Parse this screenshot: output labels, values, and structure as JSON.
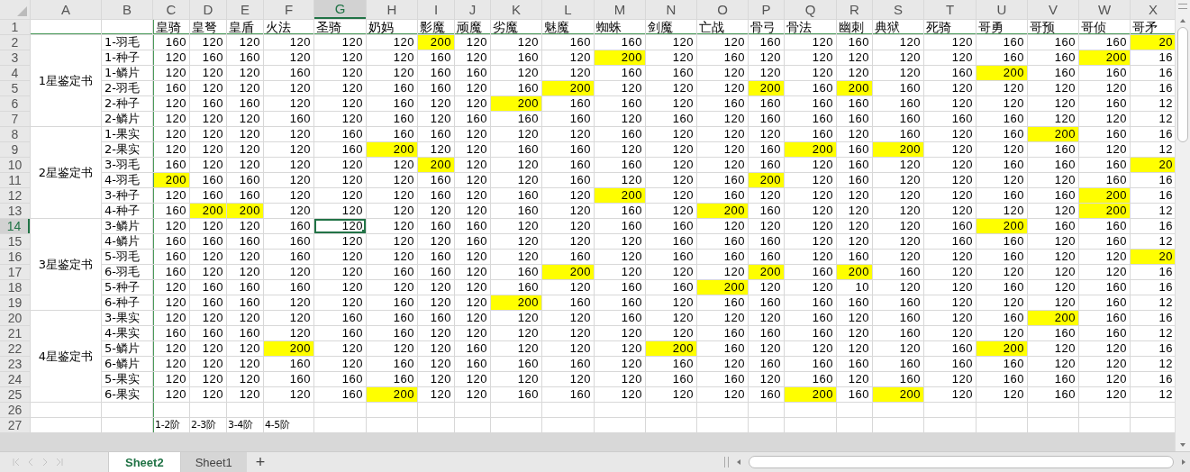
{
  "sheet": {
    "column_letters": [
      {
        "letter": "A",
        "selected": false
      },
      {
        "letter": "B",
        "selected": false
      },
      {
        "letter": "C",
        "selected": false
      },
      {
        "letter": "D",
        "selected": false
      },
      {
        "letter": "E",
        "selected": false
      },
      {
        "letter": "F",
        "selected": false
      },
      {
        "letter": "G",
        "selected": true
      },
      {
        "letter": "H",
        "selected": false
      },
      {
        "letter": "I",
        "selected": false
      },
      {
        "letter": "J",
        "selected": false
      },
      {
        "letter": "K",
        "selected": false
      },
      {
        "letter": "L",
        "selected": false
      },
      {
        "letter": "M",
        "selected": false
      },
      {
        "letter": "N",
        "selected": false
      },
      {
        "letter": "O",
        "selected": false
      },
      {
        "letter": "P",
        "selected": false
      },
      {
        "letter": "Q",
        "selected": false
      },
      {
        "letter": "R",
        "selected": false
      },
      {
        "letter": "S",
        "selected": false
      },
      {
        "letter": "T",
        "selected": false
      },
      {
        "letter": "U",
        "selected": false
      },
      {
        "letter": "V",
        "selected": false
      },
      {
        "letter": "W",
        "selected": false
      },
      {
        "letter": "X",
        "selected": false
      }
    ],
    "header_row": {
      "number": "1",
      "selected": false,
      "cells": [
        "皇骑",
        "皇弩",
        "皇盾",
        "火法",
        "圣骑",
        "奶妈",
        "影魔",
        "顽魔",
        "劣魔",
        "魅魔",
        "蜘蛛",
        "剑魔",
        "亡战",
        "骨弓",
        "骨法",
        "幽刺",
        "典狱",
        "死骑",
        "哥勇",
        "哥预",
        "哥侦",
        "哥矛"
      ]
    },
    "groups": [
      {
        "label": "1星鉴定书",
        "rows": [
          {
            "number": "2",
            "selected": false,
            "label": "1-羽毛",
            "cells": [
              "160",
              "120",
              "120",
              "120",
              "120",
              "120",
              "200",
              "120",
              "120",
              "160",
              "160",
              "120",
              "120",
              "160",
              "120",
              "160",
              "120",
              "120",
              "160",
              "160",
              "160",
              "20"
            ],
            "highlighted": [
              false,
              false,
              false,
              false,
              false,
              false,
              true,
              false,
              false,
              false,
              false,
              false,
              false,
              false,
              false,
              false,
              false,
              false,
              false,
              false,
              false,
              true
            ]
          },
          {
            "number": "3",
            "selected": false,
            "label": "1-种子",
            "cells": [
              "120",
              "160",
              "160",
              "120",
              "120",
              "120",
              "160",
              "120",
              "160",
              "120",
              "200",
              "120",
              "160",
              "120",
              "120",
              "120",
              "120",
              "120",
              "160",
              "160",
              "200",
              "16"
            ],
            "highlighted": [
              false,
              false,
              false,
              false,
              false,
              false,
              false,
              false,
              false,
              false,
              true,
              false,
              false,
              false,
              false,
              false,
              false,
              false,
              false,
              false,
              true,
              false
            ]
          },
          {
            "number": "4",
            "selected": false,
            "label": "1-鳞片",
            "cells": [
              "120",
              "120",
              "120",
              "160",
              "120",
              "120",
              "160",
              "160",
              "120",
              "120",
              "160",
              "160",
              "120",
              "120",
              "120",
              "120",
              "120",
              "160",
              "200",
              "160",
              "160",
              "16"
            ],
            "highlighted": [
              false,
              false,
              false,
              false,
              false,
              false,
              false,
              false,
              false,
              false,
              false,
              false,
              false,
              false,
              false,
              false,
              false,
              false,
              true,
              false,
              false,
              false
            ]
          },
          {
            "number": "5",
            "selected": false,
            "label": "2-羽毛",
            "cells": [
              "160",
              "120",
              "120",
              "120",
              "120",
              "160",
              "160",
              "120",
              "160",
              "200",
              "120",
              "120",
              "120",
              "200",
              "160",
              "200",
              "160",
              "120",
              "120",
              "120",
              "120",
              "16"
            ],
            "highlighted": [
              false,
              false,
              false,
              false,
              false,
              false,
              false,
              false,
              false,
              true,
              false,
              false,
              false,
              true,
              false,
              true,
              false,
              false,
              false,
              false,
              false,
              false
            ]
          },
          {
            "number": "6",
            "selected": false,
            "label": "2-种子",
            "cells": [
              "120",
              "160",
              "160",
              "120",
              "120",
              "160",
              "120",
              "120",
              "200",
              "160",
              "160",
              "120",
              "160",
              "160",
              "160",
              "160",
              "160",
              "120",
              "120",
              "120",
              "160",
              "12"
            ],
            "highlighted": [
              false,
              false,
              false,
              false,
              false,
              false,
              false,
              false,
              true,
              false,
              false,
              false,
              false,
              false,
              false,
              false,
              false,
              false,
              false,
              false,
              false,
              false
            ]
          },
          {
            "number": "7",
            "selected": false,
            "label": "2-鳞片",
            "cells": [
              "120",
              "120",
              "120",
              "160",
              "120",
              "160",
              "120",
              "160",
              "160",
              "160",
              "120",
              "160",
              "120",
              "160",
              "160",
              "160",
              "160",
              "160",
              "160",
              "120",
              "120",
              "12"
            ],
            "highlighted": [
              false,
              false,
              false,
              false,
              false,
              false,
              false,
              false,
              false,
              false,
              false,
              false,
              false,
              false,
              false,
              false,
              false,
              false,
              false,
              false,
              false,
              false
            ]
          }
        ]
      },
      {
        "label": "2星鉴定书",
        "rows": [
          {
            "number": "8",
            "selected": false,
            "label": "1-果实",
            "cells": [
              "120",
              "120",
              "120",
              "120",
              "160",
              "160",
              "160",
              "120",
              "120",
              "120",
              "160",
              "120",
              "120",
              "120",
              "160",
              "120",
              "160",
              "120",
              "160",
              "200",
              "160",
              "16"
            ],
            "highlighted": [
              false,
              false,
              false,
              false,
              false,
              false,
              false,
              false,
              false,
              false,
              false,
              false,
              false,
              false,
              false,
              false,
              false,
              false,
              false,
              true,
              false,
              false
            ]
          },
          {
            "number": "9",
            "selected": false,
            "label": "2-果实",
            "cells": [
              "120",
              "120",
              "120",
              "120",
              "160",
              "200",
              "120",
              "120",
              "160",
              "160",
              "120",
              "120",
              "120",
              "160",
              "200",
              "160",
              "200",
              "120",
              "120",
              "160",
              "120",
              "12"
            ],
            "highlighted": [
              false,
              false,
              false,
              false,
              false,
              true,
              false,
              false,
              false,
              false,
              false,
              false,
              false,
              false,
              true,
              false,
              true,
              false,
              false,
              false,
              false,
              false
            ]
          },
          {
            "number": "10",
            "selected": false,
            "label": "3-羽毛",
            "cells": [
              "160",
              "120",
              "120",
              "120",
              "120",
              "120",
              "200",
              "120",
              "120",
              "160",
              "160",
              "120",
              "120",
              "160",
              "120",
              "160",
              "120",
              "120",
              "160",
              "160",
              "160",
              "20"
            ],
            "highlighted": [
              false,
              false,
              false,
              false,
              false,
              false,
              true,
              false,
              false,
              false,
              false,
              false,
              false,
              false,
              false,
              false,
              false,
              false,
              false,
              false,
              false,
              true
            ]
          },
          {
            "number": "11",
            "selected": false,
            "label": "4-羽毛",
            "cells": [
              "200",
              "160",
              "160",
              "120",
              "120",
              "120",
              "160",
              "120",
              "120",
              "160",
              "120",
              "120",
              "160",
              "200",
              "120",
              "160",
              "120",
              "120",
              "120",
              "120",
              "160",
              "16"
            ],
            "highlighted": [
              true,
              false,
              false,
              false,
              false,
              false,
              false,
              false,
              false,
              false,
              false,
              false,
              false,
              true,
              false,
              false,
              false,
              false,
              false,
              false,
              false,
              false
            ]
          },
          {
            "number": "12",
            "selected": false,
            "label": "3-种子",
            "cells": [
              "120",
              "160",
              "160",
              "120",
              "120",
              "120",
              "160",
              "120",
              "160",
              "120",
              "200",
              "120",
              "160",
              "120",
              "120",
              "120",
              "120",
              "120",
              "160",
              "160",
              "200",
              "16"
            ],
            "highlighted": [
              false,
              false,
              false,
              false,
              false,
              false,
              false,
              false,
              false,
              false,
              true,
              false,
              false,
              false,
              false,
              false,
              false,
              false,
              false,
              false,
              true,
              false
            ]
          },
          {
            "number": "13",
            "selected": false,
            "label": "4-种子",
            "cells": [
              "160",
              "200",
              "200",
              "120",
              "120",
              "120",
              "120",
              "120",
              "160",
              "120",
              "160",
              "120",
              "200",
              "160",
              "120",
              "120",
              "120",
              "120",
              "120",
              "120",
              "200",
              "12"
            ],
            "highlighted": [
              false,
              true,
              true,
              false,
              false,
              false,
              false,
              false,
              false,
              false,
              false,
              false,
              true,
              false,
              false,
              false,
              false,
              false,
              false,
              false,
              true,
              false
            ]
          }
        ]
      },
      {
        "label": "3星鉴定书",
        "rows": [
          {
            "number": "14",
            "selected": true,
            "label": "3-鳞片",
            "cells": [
              "120",
              "120",
              "120",
              "160",
              "120",
              "120",
              "160",
              "160",
              "120",
              "120",
              "160",
              "160",
              "120",
              "120",
              "120",
              "120",
              "120",
              "160",
              "200",
              "160",
              "160",
              "16"
            ],
            "highlighted": [
              false,
              false,
              false,
              false,
              false,
              false,
              false,
              false,
              false,
              false,
              false,
              false,
              false,
              false,
              false,
              false,
              false,
              false,
              true,
              false,
              false,
              false
            ]
          },
          {
            "number": "15",
            "selected": false,
            "label": "4-鳞片",
            "cells": [
              "160",
              "160",
              "160",
              "160",
              "120",
              "120",
              "120",
              "160",
              "120",
              "120",
              "120",
              "160",
              "160",
              "160",
              "120",
              "120",
              "120",
              "160",
              "160",
              "120",
              "160",
              "12"
            ],
            "highlighted": [
              false,
              false,
              false,
              false,
              false,
              false,
              false,
              false,
              false,
              false,
              false,
              false,
              false,
              false,
              false,
              false,
              false,
              false,
              false,
              false,
              false,
              false
            ]
          },
          {
            "number": "16",
            "selected": false,
            "label": "5-羽毛",
            "cells": [
              "160",
              "120",
              "120",
              "160",
              "120",
              "120",
              "160",
              "120",
              "120",
              "160",
              "120",
              "160",
              "160",
              "160",
              "120",
              "160",
              "120",
              "120",
              "160",
              "120",
              "120",
              "20"
            ],
            "highlighted": [
              false,
              false,
              false,
              false,
              false,
              false,
              false,
              false,
              false,
              false,
              false,
              false,
              false,
              false,
              false,
              false,
              false,
              false,
              false,
              false,
              false,
              true
            ]
          },
          {
            "number": "17",
            "selected": false,
            "label": "6-羽毛",
            "cells": [
              "160",
              "120",
              "120",
              "120",
              "120",
              "160",
              "160",
              "120",
              "160",
              "200",
              "120",
              "120",
              "120",
              "200",
              "160",
              "200",
              "160",
              "120",
              "120",
              "120",
              "120",
              "16"
            ],
            "highlighted": [
              false,
              false,
              false,
              false,
              false,
              false,
              false,
              false,
              false,
              true,
              false,
              false,
              false,
              true,
              false,
              true,
              false,
              false,
              false,
              false,
              false,
              false
            ]
          },
          {
            "number": "18",
            "selected": false,
            "label": "5-种子",
            "cells": [
              "120",
              "160",
              "160",
              "160",
              "120",
              "120",
              "120",
              "120",
              "160",
              "120",
              "160",
              "160",
              "200",
              "120",
              "120",
              "10",
              "120",
              "120",
              "160",
              "120",
              "160",
              "16"
            ],
            "highlighted": [
              false,
              false,
              false,
              false,
              false,
              false,
              false,
              false,
              false,
              false,
              false,
              false,
              true,
              false,
              false,
              false,
              false,
              false,
              false,
              false,
              false,
              false
            ]
          },
          {
            "number": "19",
            "selected": false,
            "label": "6-种子",
            "cells": [
              "120",
              "160",
              "160",
              "120",
              "120",
              "160",
              "120",
              "120",
              "200",
              "160",
              "160",
              "120",
              "160",
              "160",
              "160",
              "160",
              "160",
              "120",
              "120",
              "120",
              "160",
              "12"
            ],
            "highlighted": [
              false,
              false,
              false,
              false,
              false,
              false,
              false,
              false,
              true,
              false,
              false,
              false,
              false,
              false,
              false,
              false,
              false,
              false,
              false,
              false,
              false,
              false
            ]
          }
        ]
      },
      {
        "label": "4星鉴定书",
        "rows": [
          {
            "number": "20",
            "selected": false,
            "label": "3-果实",
            "cells": [
              "120",
              "120",
              "120",
              "120",
              "160",
              "160",
              "160",
              "120",
              "120",
              "120",
              "160",
              "120",
              "120",
              "120",
              "160",
              "120",
              "160",
              "120",
              "160",
              "200",
              "160",
              "16"
            ],
            "highlighted": [
              false,
              false,
              false,
              false,
              false,
              false,
              false,
              false,
              false,
              false,
              false,
              false,
              false,
              false,
              false,
              false,
              false,
              false,
              false,
              true,
              false,
              false
            ]
          },
          {
            "number": "21",
            "selected": false,
            "label": "4-果实",
            "cells": [
              "160",
              "160",
              "160",
              "120",
              "160",
              "160",
              "120",
              "120",
              "120",
              "120",
              "120",
              "120",
              "160",
              "160",
              "160",
              "120",
              "160",
              "120",
              "120",
              "160",
              "160",
              "12"
            ],
            "highlighted": [
              false,
              false,
              false,
              false,
              false,
              false,
              false,
              false,
              false,
              false,
              false,
              false,
              false,
              false,
              false,
              false,
              false,
              false,
              false,
              false,
              false,
              false
            ]
          },
          {
            "number": "22",
            "selected": false,
            "label": "5-鳞片",
            "cells": [
              "120",
              "120",
              "120",
              "200",
              "120",
              "120",
              "120",
              "160",
              "120",
              "120",
              "120",
              "200",
              "160",
              "120",
              "120",
              "120",
              "120",
              "160",
              "200",
              "120",
              "120",
              "16"
            ],
            "highlighted": [
              false,
              false,
              false,
              true,
              false,
              false,
              false,
              false,
              false,
              false,
              false,
              true,
              false,
              false,
              false,
              false,
              false,
              false,
              true,
              false,
              false,
              false
            ]
          },
          {
            "number": "23",
            "selected": false,
            "label": "6-鳞片",
            "cells": [
              "120",
              "120",
              "120",
              "160",
              "120",
              "160",
              "120",
              "160",
              "160",
              "160",
              "120",
              "160",
              "120",
              "160",
              "160",
              "160",
              "160",
              "160",
              "160",
              "120",
              "120",
              "12"
            ],
            "highlighted": [
              false,
              false,
              false,
              false,
              false,
              false,
              false,
              false,
              false,
              false,
              false,
              false,
              false,
              false,
              false,
              false,
              false,
              false,
              false,
              false,
              false,
              false
            ]
          },
          {
            "number": "24",
            "selected": false,
            "label": "5-果实",
            "cells": [
              "120",
              "120",
              "120",
              "160",
              "160",
              "160",
              "120",
              "120",
              "120",
              "120",
              "120",
              "160",
              "160",
              "120",
              "160",
              "120",
              "160",
              "120",
              "160",
              "160",
              "120",
              "16"
            ],
            "highlighted": [
              false,
              false,
              false,
              false,
              false,
              false,
              false,
              false,
              false,
              false,
              false,
              false,
              false,
              false,
              false,
              false,
              false,
              false,
              false,
              false,
              false,
              false
            ]
          },
          {
            "number": "25",
            "selected": false,
            "label": "6-果实",
            "cells": [
              "120",
              "120",
              "120",
              "120",
              "160",
              "200",
              "120",
              "120",
              "160",
              "160",
              "120",
              "120",
              "120",
              "160",
              "200",
              "160",
              "200",
              "120",
              "120",
              "160",
              "120",
              "12"
            ],
            "highlighted": [
              false,
              false,
              false,
              false,
              false,
              true,
              false,
              false,
              false,
              false,
              false,
              false,
              false,
              false,
              true,
              false,
              true,
              false,
              false,
              false,
              false,
              false
            ]
          }
        ]
      }
    ],
    "extra_rows": [
      {
        "number": "26",
        "selected": false,
        "cells": []
      },
      {
        "number": "27",
        "selected": false,
        "cells": [
          "1-2阶",
          "2-3阶",
          "3-4阶",
          "4-5阶"
        ]
      }
    ]
  },
  "sheet_tabs": [
    {
      "label": "Sheet2",
      "selected": true
    },
    {
      "label": "Sheet1",
      "selected": false
    }
  ],
  "add_sheet_label": "+"
}
